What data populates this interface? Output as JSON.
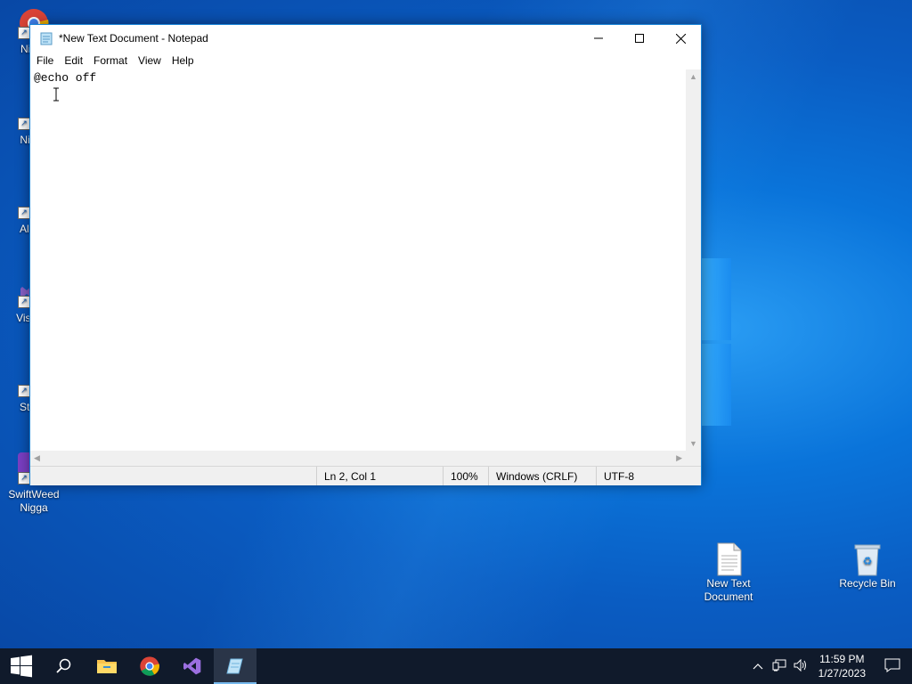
{
  "desktop": {
    "left_icons": [
      {
        "label": "Ni Ch",
        "name": "desktop-icon-chrome"
      },
      {
        "label": "Nigga",
        "name": "desktop-icon-app2"
      },
      {
        "label": "All Da",
        "name": "desktop-icon-app3"
      },
      {
        "label": "Visua 2",
        "name": "desktop-icon-visual-studio"
      },
      {
        "label": "Start I",
        "name": "desktop-icon-app5"
      },
      {
        "label": "SwiftWeed Nigga",
        "name": "desktop-icon-swiftweed"
      }
    ],
    "right_icons": [
      {
        "label": "New Text Document",
        "name": "desktop-icon-new-text-document"
      },
      {
        "label": "Recycle Bin",
        "name": "desktop-icon-recycle-bin"
      }
    ]
  },
  "notepad": {
    "title": "*New Text Document - Notepad",
    "menu": [
      "File",
      "Edit",
      "Format",
      "View",
      "Help"
    ],
    "content": "@echo off",
    "status": {
      "position": "Ln 2, Col 1",
      "zoom": "100%",
      "line_endings": "Windows (CRLF)",
      "encoding": "UTF-8"
    }
  },
  "taskbar": {
    "clock_time": "11:59 PM",
    "clock_date": "1/27/2023"
  },
  "colors": {
    "window_border": "#1883d7",
    "taskbar": "#101a2b"
  }
}
